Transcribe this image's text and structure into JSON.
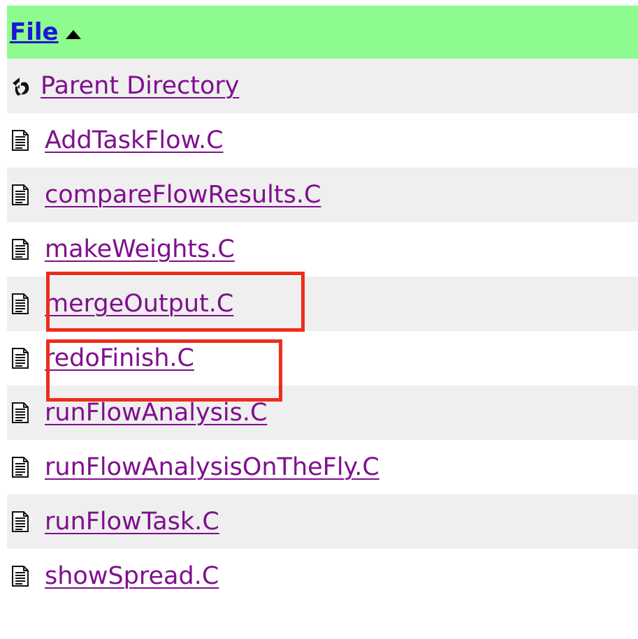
{
  "header": {
    "sort_column_label": "File",
    "sort_icon": "sort-ascending-icon"
  },
  "parent": {
    "label": "Parent Directory",
    "icon": "parent-directory-icon"
  },
  "files": [
    {
      "name": "AddTaskFlow.C",
      "icon": "text-file-icon"
    },
    {
      "name": "compareFlowResults.C",
      "icon": "text-file-icon"
    },
    {
      "name": "makeWeights.C",
      "icon": "text-file-icon"
    },
    {
      "name": "mergeOutput.C",
      "icon": "text-file-icon",
      "highlighted": true
    },
    {
      "name": "redoFinish.C",
      "icon": "text-file-icon",
      "highlighted": true
    },
    {
      "name": "runFlowAnalysis.C",
      "icon": "text-file-icon"
    },
    {
      "name": "runFlowAnalysisOnTheFly.C",
      "icon": "text-file-icon"
    },
    {
      "name": "runFlowTask.C",
      "icon": "text-file-icon"
    },
    {
      "name": "showSpread.C",
      "icon": "text-file-icon"
    }
  ],
  "colors": {
    "header_bg": "#8efb8e",
    "header_link": "#1a17d6",
    "file_link": "#7f0f8e",
    "alt_row": "#efefef",
    "highlight": "#ee2c1b"
  }
}
